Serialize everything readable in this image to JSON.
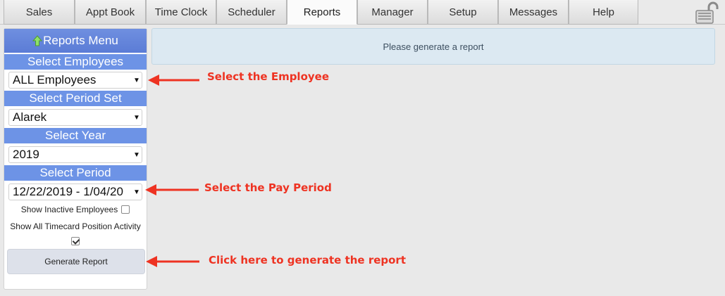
{
  "tabs": [
    {
      "label": "Sales"
    },
    {
      "label": "Appt Book"
    },
    {
      "label": "Time Clock"
    },
    {
      "label": "Scheduler"
    },
    {
      "label": "Reports",
      "active": true
    },
    {
      "label": "Manager"
    },
    {
      "label": "Setup"
    },
    {
      "label": "Messages"
    },
    {
      "label": "Help"
    }
  ],
  "sidebar": {
    "menu_title": "Reports Menu",
    "employees": {
      "label": "Select Employees",
      "value": "ALL Employees"
    },
    "period_set": {
      "label": "Select Period Set",
      "value": "Alarek"
    },
    "year": {
      "label": "Select Year",
      "value": "2019"
    },
    "period": {
      "label": "Select Period",
      "value": "12/22/2019 - 1/04/20"
    },
    "show_inactive": {
      "label": "Show Inactive Employees",
      "checked": false
    },
    "show_position_activity": {
      "label": "Show All Timecard Position Activity",
      "checked": true
    },
    "generate_button": "Generate Report"
  },
  "main": {
    "notice": "Please generate a report"
  },
  "annotations": {
    "employee": "Select the Employee",
    "pay_period": "Select the Pay Period",
    "generate": "Click here to generate the report"
  },
  "colors": {
    "menu_header": "#5b7cd6",
    "section_label": "#6d93e6",
    "notice_bg": "#dce9f2",
    "annotation": "#ee3322"
  },
  "icons": {
    "menu": "up-arrow-icon",
    "lock": "lock-icon",
    "select": "caret-down-icon"
  }
}
